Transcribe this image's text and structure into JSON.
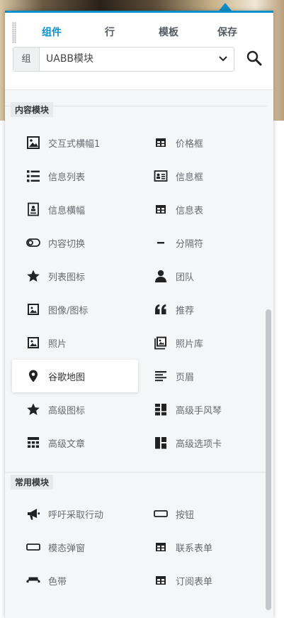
{
  "header": {
    "tabs": [
      {
        "label": "组件",
        "active": true
      },
      {
        "label": "行",
        "active": false
      },
      {
        "label": "模板",
        "active": false
      },
      {
        "label": "保存",
        "active": false
      }
    ],
    "group_prefix": "组",
    "group_value": "UABB模块"
  },
  "sections": {
    "content": {
      "label": "内容模块",
      "items": [
        {
          "label": "交互式横幅1",
          "icon": "image-icon"
        },
        {
          "label": "价格框",
          "icon": "table-icon"
        },
        {
          "label": "信息列表",
          "icon": "list-icon"
        },
        {
          "label": "信息框",
          "icon": "id-card-icon"
        },
        {
          "label": "信息横幅",
          "icon": "banner-icon"
        },
        {
          "label": "信息表",
          "icon": "table-icon"
        },
        {
          "label": "内容切换",
          "icon": "toggle-icon"
        },
        {
          "label": "分隔符",
          "icon": "minus-icon"
        },
        {
          "label": "列表图标",
          "icon": "star-icon"
        },
        {
          "label": "团队",
          "icon": "person-icon"
        },
        {
          "label": "图像/图标",
          "icon": "picture-icon"
        },
        {
          "label": "推荐",
          "icon": "quote-icon"
        },
        {
          "label": "照片",
          "icon": "picture-icon"
        },
        {
          "label": "照片库",
          "icon": "gallery-icon"
        },
        {
          "label": "谷歌地图",
          "icon": "map-marker-icon"
        },
        {
          "label": "页眉",
          "icon": "heading-icon"
        },
        {
          "label": "高级图标",
          "icon": "star-icon"
        },
        {
          "label": "高级手风琴",
          "icon": "accordion-icon"
        },
        {
          "label": "高级文章",
          "icon": "posts-grid-icon"
        },
        {
          "label": "高级选项卡",
          "icon": "tabs-icon"
        }
      ]
    },
    "common": {
      "label": "常用模块",
      "items": [
        {
          "label": "呼吁采取行动",
          "icon": "megaphone-icon"
        },
        {
          "label": "按钮",
          "icon": "button-icon"
        },
        {
          "label": "模态弹窗",
          "icon": "button-icon"
        },
        {
          "label": "联系表单",
          "icon": "table-icon"
        },
        {
          "label": "色带",
          "icon": "ribbon-icon"
        },
        {
          "label": "订阅表单",
          "icon": "table-icon"
        }
      ]
    }
  },
  "colors": {
    "accent": "#0e8ec9",
    "panel_bg": "#f5f6f7",
    "icon": "#222222"
  }
}
